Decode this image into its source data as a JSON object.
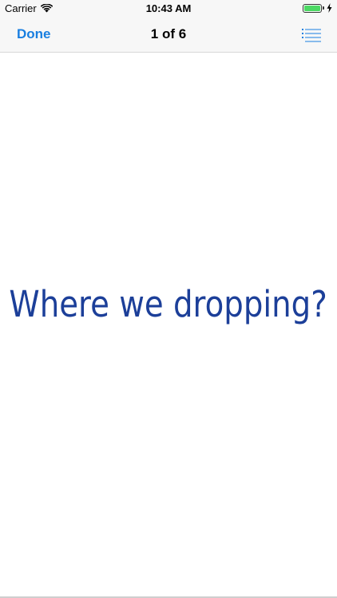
{
  "status_bar": {
    "carrier": "Carrier",
    "time": "10:43 AM",
    "battery_level": 1.0,
    "battery_color": "#4cd964"
  },
  "nav": {
    "done_label": "Done",
    "title": "1 of 6",
    "list_icon": "list-icon",
    "accent_color": "#1a7fe0"
  },
  "slide": {
    "text": "Where we dropping?",
    "text_color": "#1c3f99"
  }
}
